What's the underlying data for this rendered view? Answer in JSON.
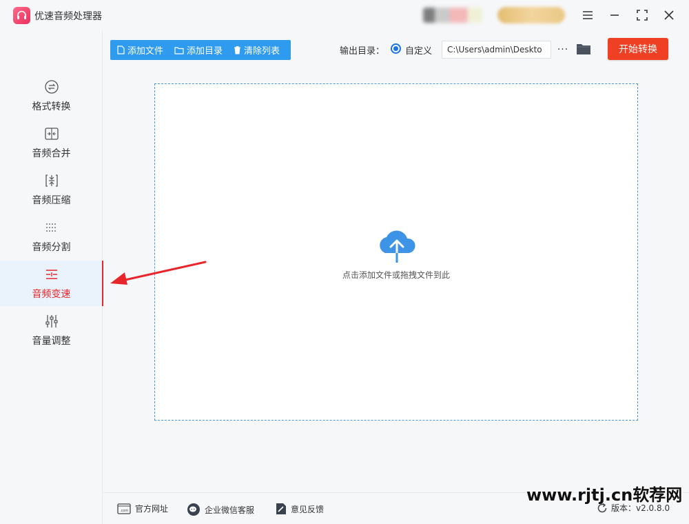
{
  "app": {
    "title": "优速音频处理器"
  },
  "sidebar": {
    "items": [
      {
        "label": "格式转换",
        "icon": "format-convert-icon"
      },
      {
        "label": "音频合并",
        "icon": "merge-icon"
      },
      {
        "label": "音频压缩",
        "icon": "compress-icon"
      },
      {
        "label": "音频分割",
        "icon": "split-icon"
      },
      {
        "label": "音频变速",
        "icon": "speed-icon",
        "active": true
      },
      {
        "label": "音量调整",
        "icon": "volume-sliders-icon"
      }
    ]
  },
  "toolbar": {
    "add_file": "添加文件",
    "add_dir": "添加目录",
    "clear_list": "清除列表",
    "output_label": "输出目录：",
    "custom_label": "自定义",
    "output_path": "C:\\Users\\admin\\Deskto",
    "more": "···",
    "start": "开始转换"
  },
  "main": {
    "drop_hint": "点击添加文件或拖拽文件到此"
  },
  "footer": {
    "website": "官方网址",
    "wechat": "企业微信客服",
    "feedback": "意见反馈",
    "version": "版本：v2.0.8.0"
  },
  "watermark": "www.rjtj.cn软荐网",
  "colors": {
    "accent": "#2f9bee",
    "start": "#ef4023",
    "active": "#e8252b",
    "cloud": "#3d94e6"
  }
}
